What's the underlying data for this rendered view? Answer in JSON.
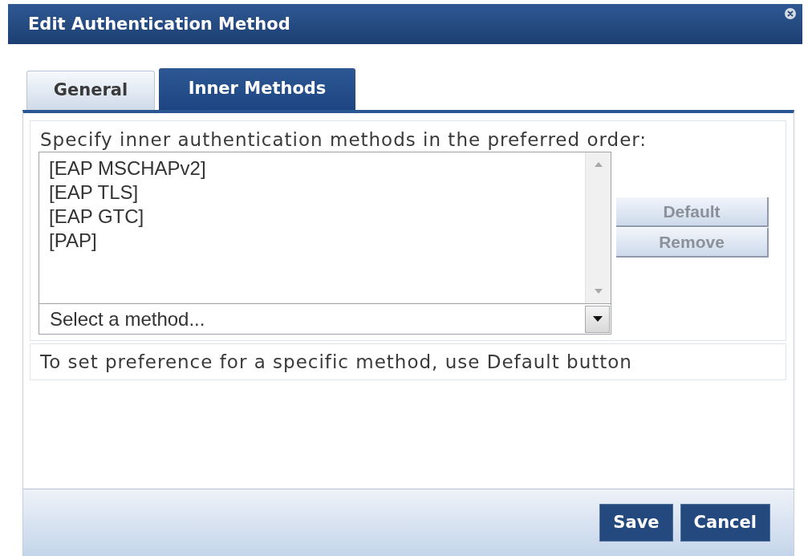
{
  "dialog": {
    "title": "Edit Authentication Method"
  },
  "tabs": [
    {
      "label": "General",
      "selected": false
    },
    {
      "label": "Inner Methods",
      "selected": true
    }
  ],
  "inner_methods": {
    "instruction": "Specify inner authentication methods in the preferred order:",
    "methods": [
      {
        "label": "[EAP MSCHAPv2]",
        "selected": false
      },
      {
        "label": "[EAP TLS]",
        "selected": false
      },
      {
        "label": "[EAP GTC]",
        "selected": false
      },
      {
        "label": "[PAP]",
        "selected": false
      }
    ],
    "method_select": {
      "placeholder": "Select a method..."
    },
    "buttons": [
      {
        "label": "Default",
        "disabled": true
      },
      {
        "label": "Remove",
        "disabled": true
      }
    ],
    "hint": "To set preference for a specific method, use Default button"
  },
  "footer_buttons": [
    {
      "label": "Save"
    },
    {
      "label": "Cancel"
    }
  ]
}
